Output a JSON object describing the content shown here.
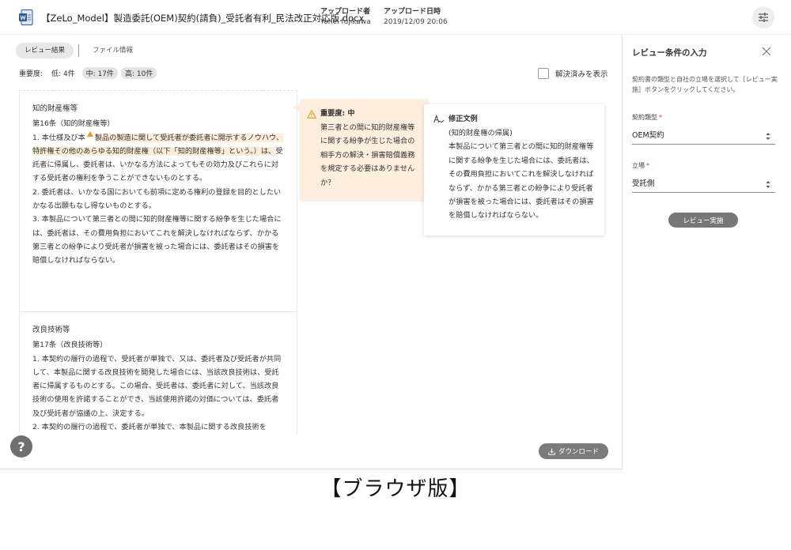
{
  "header": {
    "doc_title": "【ZeLo_Model】製造委託(OEM)契約(請負)_受託者有利_民法改正対応版.docx",
    "uploader_label": "アップロード者",
    "uploader_value": "Yohei fujikawa",
    "date_label": "アップロード日時",
    "date_value": "2019/12/09 20:06",
    "icons": {
      "doc": "word-doc-icon",
      "settings": "sliders-icon"
    }
  },
  "tabs": [
    {
      "label": "レビュー結果",
      "active": true
    },
    {
      "label": "ファイル情報",
      "active": false
    }
  ],
  "severity": {
    "label": "重要度:",
    "low": "低: 4件",
    "mid": "中: 17件",
    "high": "高: 10件"
  },
  "resolved_toggle": {
    "label": "解決済みを表示",
    "checked": false
  },
  "document": {
    "section1": {
      "title": "知的財産権等",
      "article": "第16条（知的財産権等）",
      "p1_a": "1. 本仕様及び本",
      "p1_b": "製品の製造に関して受託者が委託者に開示するノウハウ、特許権その他のあらゆる知的財産権（以下「知的財産権等」という。）は、",
      "p1_c": "受託者に帰属し、委託者は、いかなる方法によってもその効力及びこれらに対する受託者の権利を争うことができないものとする。",
      "p2": "2. 委託者は、いかなる国においても前項に定める権利の登録を目的としたいかなる出願もなし得ないものとする。",
      "p3": "3. 本製品について第三者との間に知的財産権等に関する紛争を生じた場合には、委託者は、その費用負担においてこれを解決しなければならず、かかる第三者との紛争により受託者が損害を被った場合には、委託者はその損害を賠償しなければならない。"
    },
    "section2": {
      "title": "改良技術等",
      "article": "第17条（改良技術等）",
      "p1": "1. 本契約の履行の過程で、受託者が単独で、又は、委託者及び受託者が共同して、本製品に関する改良技術を開発した場合には、当該改良技術は、受託者に帰属するものとする。この場合、受託者は、委託者に対して、当該改良技術の使用を許諾することができ、当該使用許諾の対価については、委託者及び受託者が協議の上、決定する。",
      "p2": "2. 本契約の履行の過程で、委託者が単独で、本製品に関する改良技術を"
    }
  },
  "issue": {
    "severity": "重要度: 中",
    "text": "第三者との間に知的財産権等に関する紛争が生じた場合の相手方の解決・損害賠償義務を規定する必要はありませんか？",
    "icon": "warning-icon"
  },
  "revision": {
    "title": "修正文例",
    "subtitle": "(知的財産権の帰属)",
    "text": "本製品について第三者との間に知的財産権等に関する紛争を生じた場合には、委託者は、その費用負担においてこれを解決しなければならず、かかる第三者との紛争により受託者が損害を被った場合には、委託者はその損害を賠償しなければならない。",
    "icon": "edit-text-icon"
  },
  "download_label": "ダウンロード",
  "help_label": "?",
  "panel": {
    "title": "レビュー条件の入力",
    "description": "契約書の類型と自社の立場を選択して［レビュー実施］ボタンをクリックしてください。",
    "contract_type_label": "契約類型",
    "contract_type_value": "OEM契約",
    "position_label": "立場",
    "position_value": "受託側",
    "required_mark": "*",
    "review_button": "レビュー実施"
  },
  "caption": "【ブラウザ版】",
  "colors": {
    "highlight": "#fcecd8",
    "issue_bg": "#fdeedd",
    "warning": "#e89a2c",
    "button": "#777777"
  }
}
